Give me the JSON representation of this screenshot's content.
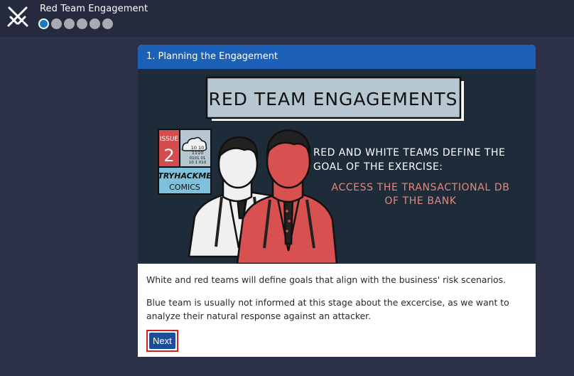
{
  "app": {
    "title": "Red Team Engagement",
    "icon": "crossed-swords-icon"
  },
  "progress": {
    "total_steps": 6,
    "current_step": 1
  },
  "card": {
    "header": "1. Planning the Engagement",
    "comic": {
      "title": "RED TEAM ENGAGEMENTS",
      "issue_label": "ISSUE",
      "issue_number": "2",
      "bits_lines": [
        "10  10",
        "1110",
        "0101 01",
        "10 1 010"
      ],
      "brand": "TRYHACKME",
      "brand_sub": "COMICS",
      "caption_line1": "RED AND WHITE TEAMS DEFINE THE",
      "caption_line2": "GOAL OF THE EXERCISE:",
      "goal_line1": "ACCESS THE TRANSACTIONAL DB",
      "goal_line2": "OF THE BANK"
    },
    "paragraphs": [
      "White and red teams will define goals that align with the business' risk scenarios.",
      "Blue team is usually not informed at this stage about the excercise, as we want to analyze their natural response against an attacker."
    ],
    "next_label": "Next"
  },
  "colors": {
    "background": "#2c3148",
    "topbar": "#262a3f",
    "header_blue": "#1c60b8",
    "comic_bg": "#1e2b39",
    "red_figure": "#d85050",
    "goal_text": "#e08a80",
    "button_blue": "#1c4e98",
    "highlight_red": "#d01f1f"
  }
}
